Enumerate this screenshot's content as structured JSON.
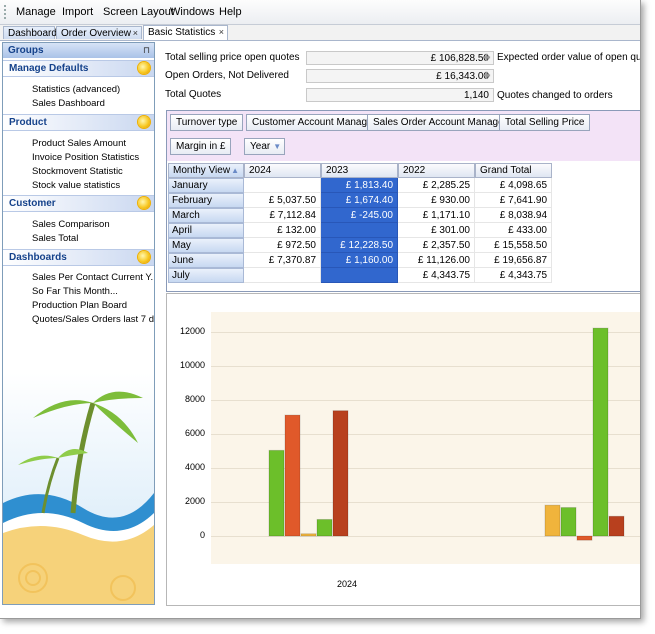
{
  "menu": {
    "items": [
      "Manage",
      "Import",
      "Screen Layout",
      "Windows",
      "Help"
    ]
  },
  "tabs": [
    {
      "label": "Dashboard"
    },
    {
      "label": "Order Overview",
      "close": "×"
    },
    {
      "label": "Basic Statistics",
      "close": "×"
    }
  ],
  "sidebar": {
    "title": "Groups",
    "pin": "⊓",
    "groups": [
      {
        "title": "Manage Defaults",
        "items": [
          "Statistics (advanced)",
          "Sales Dashboard"
        ]
      },
      {
        "title": "Product",
        "items": [
          "Product Sales Amount",
          "Invoice Position Statistics",
          "Stockmovent Statistic",
          "Stock value statistics"
        ]
      },
      {
        "title": "Customer",
        "items": [
          "Sales Comparison",
          "Sales Total"
        ]
      },
      {
        "title": "Dashboards",
        "items": [
          "Sales Per Contact Current Y...",
          "So Far This Month...",
          "Production Plan Board",
          "Quotes/Sales Orders last 7 d..."
        ]
      }
    ]
  },
  "summary": {
    "total_selling_label": "Total selling price open quotes",
    "total_selling_value": "£ 106,828.50",
    "expected_label": "Expected order value of open quotes",
    "open_orders_label": "Open Orders, Not Delivered",
    "open_orders_value": "£ 16,343.00",
    "total_quotes_label": "Total Quotes",
    "total_quotes_value": "1,140",
    "changed_label": "Quotes changed to orders"
  },
  "pivot": {
    "filters": [
      "Turnover type",
      "Customer Account Manager",
      "Sales Order Account Manager",
      "Total Selling Price"
    ],
    "margin_label": "Margin in £",
    "year_label": "Year",
    "view_label": "Monthy View",
    "columns": [
      "2024",
      "2023",
      "2022",
      "Grand Total"
    ],
    "rows": [
      {
        "month": "January",
        "cells": [
          "",
          "£ 1,813.40",
          "£ 2,285.25",
          "£ 4,098.65"
        ]
      },
      {
        "month": "February",
        "cells": [
          "£ 5,037.50",
          "£ 1,674.40",
          "£ 930.00",
          "£ 7,641.90"
        ]
      },
      {
        "month": "March",
        "cells": [
          "£ 7,112.84",
          "£ -245.00",
          "£ 1,171.10",
          "£ 8,038.94"
        ]
      },
      {
        "month": "April",
        "cells": [
          "£ 132.00",
          "",
          "£ 301.00",
          "£ 433.00"
        ]
      },
      {
        "month": "May",
        "cells": [
          "£ 972.50",
          "£ 12,228.50",
          "£ 2,357.50",
          "£ 15,558.50"
        ]
      },
      {
        "month": "June",
        "cells": [
          "£ 7,370.87",
          "£ 1,160.00",
          "£ 11,126.00",
          "£ 19,656.87"
        ]
      },
      {
        "month": "July",
        "cells": [
          "",
          "",
          "£ 4,343.75",
          "£ 4,343.75"
        ]
      }
    ]
  },
  "chart_data": {
    "type": "bar",
    "ylim": [
      -500,
      13000
    ],
    "yticks": [
      0,
      2000,
      4000,
      6000,
      8000,
      10000,
      12000
    ],
    "xlabel_visible": "2024",
    "grid": true,
    "groups": [
      {
        "label": "2024",
        "bars": [
          {
            "value": 5037.5,
            "color": "#6cbf2a"
          },
          {
            "value": 7112.84,
            "color": "#e0592a"
          },
          {
            "value": 132,
            "color": "#f0b43c"
          },
          {
            "value": 972.5,
            "color": "#6cbf2a"
          },
          {
            "value": 7370.87,
            "color": "#b8401e"
          }
        ]
      },
      {
        "label": "",
        "bars": [
          {
            "value": 1813.4,
            "color": "#f0b43c"
          },
          {
            "value": 1674.4,
            "color": "#6cbf2a"
          },
          {
            "value": -245,
            "color": "#e0592a"
          },
          {
            "value": 12228.5,
            "color": "#6cbf2a"
          },
          {
            "value": 1160,
            "color": "#b8401e"
          }
        ]
      }
    ]
  }
}
